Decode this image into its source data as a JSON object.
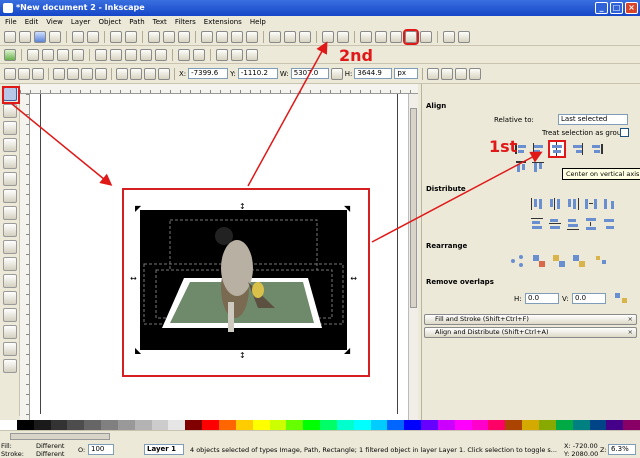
{
  "window": {
    "title": "*New document 2 - Inkscape",
    "min": "_",
    "max": "□",
    "close": "×"
  },
  "menu": [
    "File",
    "Edit",
    "View",
    "Layer",
    "Object",
    "Path",
    "Text",
    "Filters",
    "Extensions",
    "Help"
  ],
  "toolbar": {
    "x_label": "X:",
    "x_value": "-7399.6",
    "y_label": "Y:",
    "y_value": "-1110.2",
    "w_label": "W:",
    "w_value": "5307.0",
    "h_label": "H:",
    "h_value": "3644.9",
    "unit": "px"
  },
  "callouts": {
    "first": "1st",
    "second": "2nd"
  },
  "tooltip": "Center on vertical axis",
  "dock": {
    "align_title": "Align",
    "relative_to_label": "Relative to:",
    "relative_to_value": "Last selected",
    "treat_group_label": "Treat selection as group:",
    "distribute_title": "Distribute",
    "rearrange_title": "Rearrange",
    "remove_overlaps_title": "Remove overlaps",
    "h_label": "H:",
    "h_value": "0.0",
    "v_label": "V:",
    "v_value": "0.0",
    "panels": [
      "Fill and Stroke (Shift+Ctrl+F)",
      "Align and Distribute (Shift+Ctrl+A)"
    ]
  },
  "status": {
    "fill_label": "Fill:",
    "fill_value": "Different",
    "stroke_label": "Stroke:",
    "stroke_value": "Different",
    "opacity_label": "O:",
    "opacity_value": "100",
    "layer": "Layer 1",
    "message": "4 objects selected of types Image, Path, Rectangle; 1 filtered object in layer Layer 1. Click selection to toggle s...",
    "x_coord": "X: -720.00",
    "y_coord": "Y: 2080.00",
    "zoom_label": "Z:",
    "zoom_value": "6.3%"
  },
  "colors": {
    "accent_red": "#e01818",
    "titlebar": "#1f52cf"
  }
}
